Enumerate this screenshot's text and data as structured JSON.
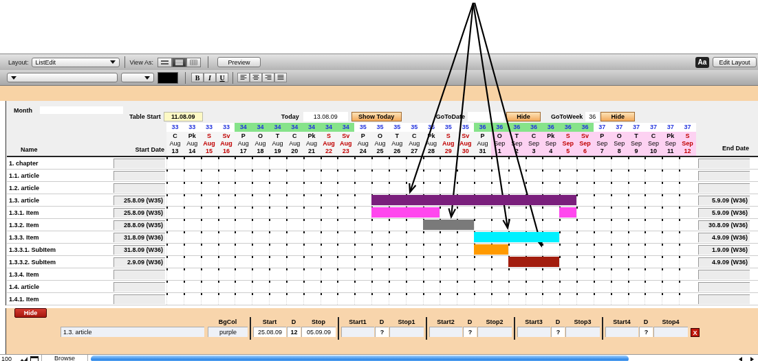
{
  "toolbar": {
    "layout_label": "Layout:",
    "layout_value": "ListEdit",
    "view_as_label": "View As:",
    "view_modes": [
      {
        "selected": false
      },
      {
        "selected": true
      },
      {
        "selected": false
      }
    ],
    "preview": "Preview",
    "font_button": "Aa",
    "edit_layout": "Edit Layout"
  },
  "format_bar": {
    "bold": "B",
    "italic": "I",
    "underline": "U"
  },
  "controls": {
    "month_label": "Month",
    "table_start_label": "Table Start",
    "table_start": "11.08.09",
    "today_label": "Today",
    "today": "13.08.09",
    "show_today": "Show Today",
    "goto_date_label": "GoToDate",
    "goto_date_hide": "Hide",
    "goto_week_label": "GoToWeek",
    "goto_week": "36",
    "goto_week_hide": "Hide"
  },
  "columns": {
    "name": "Name",
    "start": "Start Date",
    "end": "End Date"
  },
  "days": [
    {
      "week": "33",
      "week_shaded": false,
      "weekday": "C",
      "month": "Aug",
      "day": "13",
      "weekend": false,
      "shaded": false
    },
    {
      "week": "33",
      "week_shaded": false,
      "weekday": "Pk",
      "month": "Aug",
      "day": "14",
      "weekend": false,
      "shaded": false
    },
    {
      "week": "33",
      "week_shaded": false,
      "weekday": "S",
      "month": "Aug",
      "day": "15",
      "weekend": true,
      "shaded": false
    },
    {
      "week": "33",
      "week_shaded": false,
      "weekday": "Sv",
      "month": "Aug",
      "day": "16",
      "weekend": true,
      "shaded": false
    },
    {
      "week": "34",
      "week_shaded": true,
      "weekday": "P",
      "month": "Aug",
      "day": "17",
      "weekend": false,
      "shaded": false
    },
    {
      "week": "34",
      "week_shaded": true,
      "weekday": "O",
      "month": "Aug",
      "day": "18",
      "weekend": false,
      "shaded": false
    },
    {
      "week": "34",
      "week_shaded": true,
      "weekday": "T",
      "month": "Aug",
      "day": "19",
      "weekend": false,
      "shaded": false
    },
    {
      "week": "34",
      "week_shaded": true,
      "weekday": "C",
      "month": "Aug",
      "day": "20",
      "weekend": false,
      "shaded": false
    },
    {
      "week": "34",
      "week_shaded": true,
      "weekday": "Pk",
      "month": "Aug",
      "day": "21",
      "weekend": false,
      "shaded": false
    },
    {
      "week": "34",
      "week_shaded": true,
      "weekday": "S",
      "month": "Aug",
      "day": "22",
      "weekend": true,
      "shaded": false
    },
    {
      "week": "34",
      "week_shaded": true,
      "weekday": "Sv",
      "month": "Aug",
      "day": "23",
      "weekend": true,
      "shaded": false
    },
    {
      "week": "35",
      "week_shaded": false,
      "weekday": "P",
      "month": "Aug",
      "day": "24",
      "weekend": false,
      "shaded": false
    },
    {
      "week": "35",
      "week_shaded": false,
      "weekday": "O",
      "month": "Aug",
      "day": "25",
      "weekend": false,
      "shaded": false
    },
    {
      "week": "35",
      "week_shaded": false,
      "weekday": "T",
      "month": "Aug",
      "day": "26",
      "weekend": false,
      "shaded": false
    },
    {
      "week": "35",
      "week_shaded": false,
      "weekday": "C",
      "month": "Aug",
      "day": "27",
      "weekend": false,
      "shaded": false
    },
    {
      "week": "35",
      "week_shaded": false,
      "weekday": "Pk",
      "month": "Aug",
      "day": "28",
      "weekend": false,
      "shaded": false
    },
    {
      "week": "35",
      "week_shaded": false,
      "weekday": "S",
      "month": "Aug",
      "day": "29",
      "weekend": true,
      "shaded": false
    },
    {
      "week": "35",
      "week_shaded": false,
      "weekday": "Sv",
      "month": "Aug",
      "day": "30",
      "weekend": true,
      "shaded": false
    },
    {
      "week": "36",
      "week_shaded": true,
      "weekday": "P",
      "month": "Aug",
      "day": "31",
      "weekend": false,
      "shaded": false
    },
    {
      "week": "36",
      "week_shaded": true,
      "weekday": "O",
      "month": "Sep",
      "day": "1",
      "weekend": false,
      "shaded": true
    },
    {
      "week": "36",
      "week_shaded": true,
      "weekday": "T",
      "month": "Sep",
      "day": "2",
      "weekend": false,
      "shaded": true
    },
    {
      "week": "36",
      "week_shaded": true,
      "weekday": "C",
      "month": "Sep",
      "day": "3",
      "weekend": false,
      "shaded": true
    },
    {
      "week": "36",
      "week_shaded": true,
      "weekday": "Pk",
      "month": "Sep",
      "day": "4",
      "weekend": false,
      "shaded": true
    },
    {
      "week": "36",
      "week_shaded": true,
      "weekday": "S",
      "month": "Sep",
      "day": "5",
      "weekend": true,
      "shaded": true
    },
    {
      "week": "36",
      "week_shaded": true,
      "weekday": "Sv",
      "month": "Sep",
      "day": "6",
      "weekend": true,
      "shaded": true
    },
    {
      "week": "37",
      "week_shaded": false,
      "weekday": "P",
      "month": "Sep",
      "day": "7",
      "weekend": false,
      "shaded": true
    },
    {
      "week": "37",
      "week_shaded": false,
      "weekday": "O",
      "month": "Sep",
      "day": "8",
      "weekend": false,
      "shaded": true
    },
    {
      "week": "37",
      "week_shaded": false,
      "weekday": "T",
      "month": "Sep",
      "day": "9",
      "weekend": false,
      "shaded": true
    },
    {
      "week": "37",
      "week_shaded": false,
      "weekday": "C",
      "month": "Sep",
      "day": "10",
      "weekend": false,
      "shaded": true
    },
    {
      "week": "37",
      "week_shaded": false,
      "weekday": "Pk",
      "month": "Sep",
      "day": "11",
      "weekend": false,
      "shaded": true
    },
    {
      "week": "37",
      "week_shaded": false,
      "weekday": "S",
      "month": "Sep",
      "day": "12",
      "weekend": true,
      "shaded": true
    }
  ],
  "rows": [
    {
      "name": "1. chapter"
    },
    {
      "name": "1.1. article"
    },
    {
      "name": "1.2. article"
    },
    {
      "name": "1.3. article",
      "start": "25.8.09 (W35)",
      "end": "5.9.09 (W36)",
      "timeline": [
        {
          "filled": false
        },
        {
          "filled": false
        },
        {
          "filled": false
        },
        {
          "filled": false
        },
        {
          "filled": false
        },
        {
          "filled": false
        },
        {
          "filled": false
        },
        {
          "filled": false
        },
        {
          "filled": false
        },
        {
          "filled": false
        },
        {
          "filled": false
        },
        {
          "filled": false
        },
        {
          "filled": true,
          "color": "#7a1f7c"
        },
        {
          "filled": true,
          "color": "#7a1f7c"
        },
        {
          "filled": true,
          "color": "#7a1f7c"
        },
        {
          "filled": true,
          "color": "#7a1f7c"
        },
        {
          "filled": true,
          "color": "#7a1f7c"
        },
        {
          "filled": true,
          "color": "#7a1f7c"
        },
        {
          "filled": true,
          "color": "#7a1f7c"
        },
        {
          "filled": true,
          "color": "#7a1f7c"
        },
        {
          "filled": true,
          "color": "#7a1f7c"
        },
        {
          "filled": true,
          "color": "#7a1f7c"
        },
        {
          "filled": true,
          "color": "#7a1f7c"
        },
        {
          "filled": true,
          "color": "#7a1f7c"
        },
        {
          "filled": false
        },
        {
          "filled": false
        },
        {
          "filled": false
        },
        {
          "filled": false
        },
        {
          "filled": false
        },
        {
          "filled": false
        },
        {
          "filled": false
        }
      ]
    },
    {
      "name": "1.3.1. Item",
      "start": "25.8.09 (W35)",
      "end": "5.9.09 (W36)",
      "timeline": [
        {
          "filled": false
        },
        {
          "filled": false
        },
        {
          "filled": false
        },
        {
          "filled": false
        },
        {
          "filled": false
        },
        {
          "filled": false
        },
        {
          "filled": false
        },
        {
          "filled": false
        },
        {
          "filled": false
        },
        {
          "filled": false
        },
        {
          "filled": false
        },
        {
          "filled": false
        },
        {
          "filled": true,
          "color": "#ff47ee"
        },
        {
          "filled": true,
          "color": "#ff47ee"
        },
        {
          "filled": true,
          "color": "#ff47ee"
        },
        {
          "filled": true,
          "color": "#ff47ee"
        },
        {
          "filled": false
        },
        {
          "filled": false
        },
        {
          "filled": false
        },
        {
          "filled": false
        },
        {
          "filled": false
        },
        {
          "filled": false
        },
        {
          "filled": false
        },
        {
          "filled": true,
          "color": "#ff47ee"
        },
        {
          "filled": false
        },
        {
          "filled": false
        },
        {
          "filled": false
        },
        {
          "filled": false
        },
        {
          "filled": false
        },
        {
          "filled": false
        },
        {
          "filled": false
        }
      ]
    },
    {
      "name": "1.3.2. Item",
      "start": "28.8.09 (W35)",
      "end": "30.8.09 (W36)",
      "timeline": [
        {
          "filled": false
        },
        {
          "filled": false
        },
        {
          "filled": false
        },
        {
          "filled": false
        },
        {
          "filled": false
        },
        {
          "filled": false
        },
        {
          "filled": false
        },
        {
          "filled": false
        },
        {
          "filled": false
        },
        {
          "filled": false
        },
        {
          "filled": false
        },
        {
          "filled": false
        },
        {
          "filled": false
        },
        {
          "filled": false
        },
        {
          "filled": false
        },
        {
          "filled": true,
          "color": "#7a7a7a"
        },
        {
          "filled": true,
          "color": "#7a7a7a"
        },
        {
          "filled": true,
          "color": "#7a7a7a"
        },
        {
          "filled": false
        },
        {
          "filled": false
        },
        {
          "filled": false
        },
        {
          "filled": false
        },
        {
          "filled": false
        },
        {
          "filled": false
        },
        {
          "filled": false
        },
        {
          "filled": false
        },
        {
          "filled": false
        },
        {
          "filled": false
        },
        {
          "filled": false
        },
        {
          "filled": false
        },
        {
          "filled": false
        }
      ]
    },
    {
      "name": "1.3.3. Item",
      "start": "31.8.09 (W36)",
      "end": "4.9.09 (W36)",
      "timeline": [
        {
          "filled": false
        },
        {
          "filled": false
        },
        {
          "filled": false
        },
        {
          "filled": false
        },
        {
          "filled": false
        },
        {
          "filled": false
        },
        {
          "filled": false
        },
        {
          "filled": false
        },
        {
          "filled": false
        },
        {
          "filled": false
        },
        {
          "filled": false
        },
        {
          "filled": false
        },
        {
          "filled": false
        },
        {
          "filled": false
        },
        {
          "filled": false
        },
        {
          "filled": false
        },
        {
          "filled": false
        },
        {
          "filled": false
        },
        {
          "filled": true,
          "color": "#00f0ff"
        },
        {
          "filled": true,
          "color": "#00f0ff"
        },
        {
          "filled": true,
          "color": "#00f0ff"
        },
        {
          "filled": true,
          "color": "#00f0ff"
        },
        {
          "filled": true,
          "color": "#00f0ff"
        },
        {
          "filled": false
        },
        {
          "filled": false
        },
        {
          "filled": false
        },
        {
          "filled": false
        },
        {
          "filled": false
        },
        {
          "filled": false
        },
        {
          "filled": false
        },
        {
          "filled": false
        }
      ]
    },
    {
      "name": "1.3.3.1. SubItem",
      "start": "31.8.09 (W36)",
      "end": "1.9.09 (W36)",
      "timeline": [
        {
          "filled": false
        },
        {
          "filled": false
        },
        {
          "filled": false
        },
        {
          "filled": false
        },
        {
          "filled": false
        },
        {
          "filled": false
        },
        {
          "filled": false
        },
        {
          "filled": false
        },
        {
          "filled": false
        },
        {
          "filled": false
        },
        {
          "filled": false
        },
        {
          "filled": false
        },
        {
          "filled": false
        },
        {
          "filled": false
        },
        {
          "filled": false
        },
        {
          "filled": false
        },
        {
          "filled": false
        },
        {
          "filled": false
        },
        {
          "filled": true,
          "color": "#ff9a00"
        },
        {
          "filled": true,
          "color": "#ff9a00"
        },
        {
          "filled": false
        },
        {
          "filled": false
        },
        {
          "filled": false
        },
        {
          "filled": false
        },
        {
          "filled": false
        },
        {
          "filled": false
        },
        {
          "filled": false
        },
        {
          "filled": false
        },
        {
          "filled": false
        },
        {
          "filled": false
        },
        {
          "filled": false
        }
      ]
    },
    {
      "name": "1.3.3.2. SubItem",
      "start": "2.9.09 (W36)",
      "end": "4.9.09 (W36)",
      "timeline": [
        {
          "filled": false
        },
        {
          "filled": false
        },
        {
          "filled": false
        },
        {
          "filled": false
        },
        {
          "filled": false
        },
        {
          "filled": false
        },
        {
          "filled": false
        },
        {
          "filled": false
        },
        {
          "filled": false
        },
        {
          "filled": false
        },
        {
          "filled": false
        },
        {
          "filled": false
        },
        {
          "filled": false
        },
        {
          "filled": false
        },
        {
          "filled": false
        },
        {
          "filled": false
        },
        {
          "filled": false
        },
        {
          "filled": false
        },
        {
          "filled": false
        },
        {
          "filled": false
        },
        {
          "filled": true,
          "color": "#a21d0e"
        },
        {
          "filled": true,
          "color": "#a21d0e"
        },
        {
          "filled": true,
          "color": "#a21d0e"
        },
        {
          "filled": false
        },
        {
          "filled": false
        },
        {
          "filled": false
        },
        {
          "filled": false
        },
        {
          "filled": false
        },
        {
          "filled": false
        },
        {
          "filled": false
        },
        {
          "filled": false
        }
      ]
    },
    {
      "name": "1.3.4. Item"
    },
    {
      "name": "1.4. article"
    },
    {
      "name": "1.4.1. Item"
    }
  ],
  "editor": {
    "hide": "Hide",
    "name": "1.3. article",
    "bgcol_label": "BgCol",
    "bgcol": "purple",
    "close": "X",
    "periods": [
      {
        "start_label": "Start",
        "d_label": "D",
        "stop_label": "Stop",
        "start": "25.08.09",
        "d": "12",
        "stop": "05.09.09"
      },
      {
        "start_label": "Start1",
        "d_label": "D",
        "stop_label": "Stop1",
        "d": "?"
      },
      {
        "start_label": "Start2",
        "d_label": "D",
        "stop_label": "Stop2",
        "d": "?"
      },
      {
        "start_label": "Start3",
        "d_label": "D",
        "stop_label": "Stop3",
        "d": "?"
      },
      {
        "start_label": "Start4",
        "d_label": "D",
        "stop_label": "Stop4",
        "d": "?"
      }
    ]
  },
  "status_bar": {
    "zoom": "100",
    "mode": "Browse"
  }
}
